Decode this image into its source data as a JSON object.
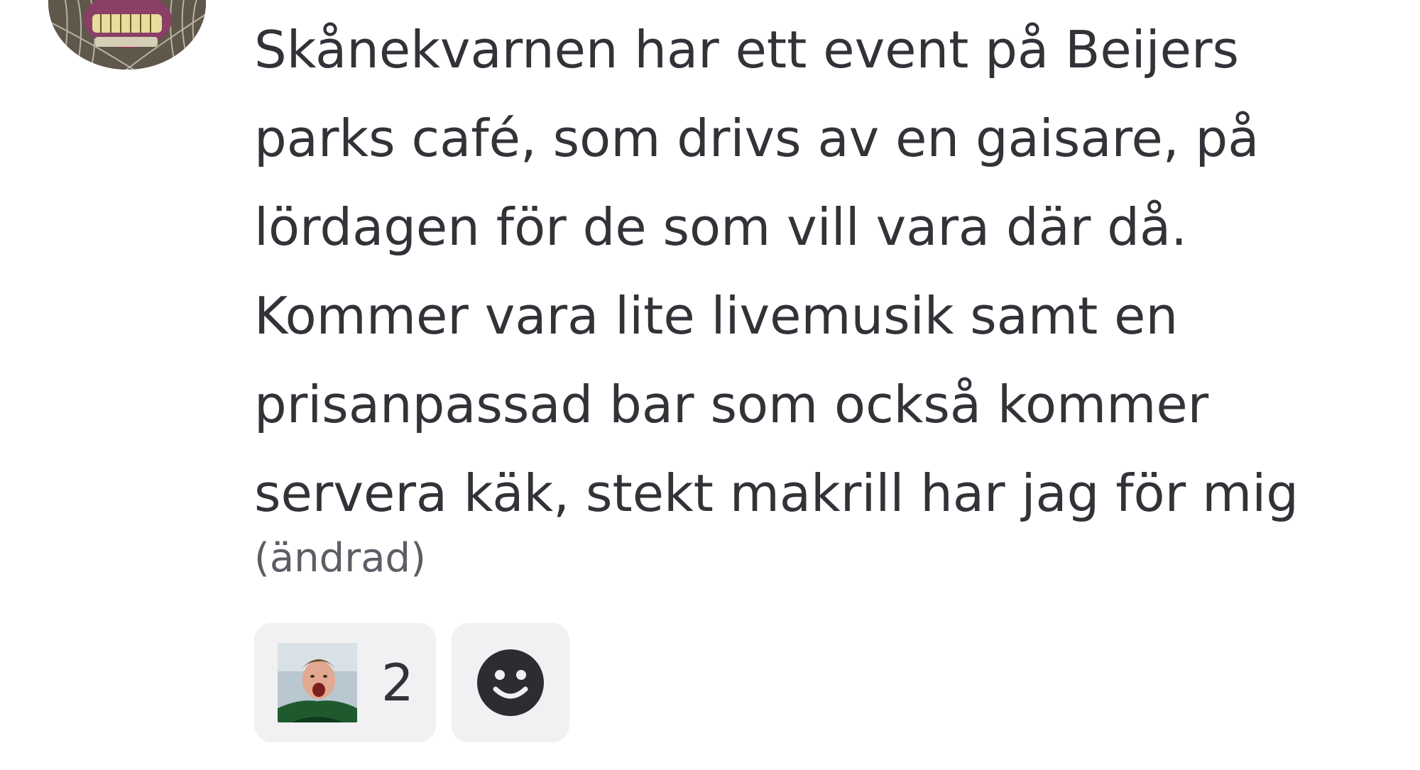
{
  "message": {
    "lines": [
      "Skånekvarnen har ett event på Beijers",
      "parks café, som drivs av en gaisare, på",
      "lördagen för de som vill vara där då.",
      "Kommer vara lite livemusik samt en",
      "prisanpassad bar som också kommer",
      "servera käk, stekt makrill har jag för mig"
    ],
    "edited_label": "(ändrad)"
  },
  "reactions": [
    {
      "emoji": "custom-player-emoji",
      "count": "2"
    }
  ],
  "add_reaction": {
    "icon": "smiley-face-icon"
  },
  "colors": {
    "text": "#313338",
    "muted": "#5c5e66",
    "reaction_bg": "#f1f1f3",
    "icon": "#2b2d31"
  }
}
